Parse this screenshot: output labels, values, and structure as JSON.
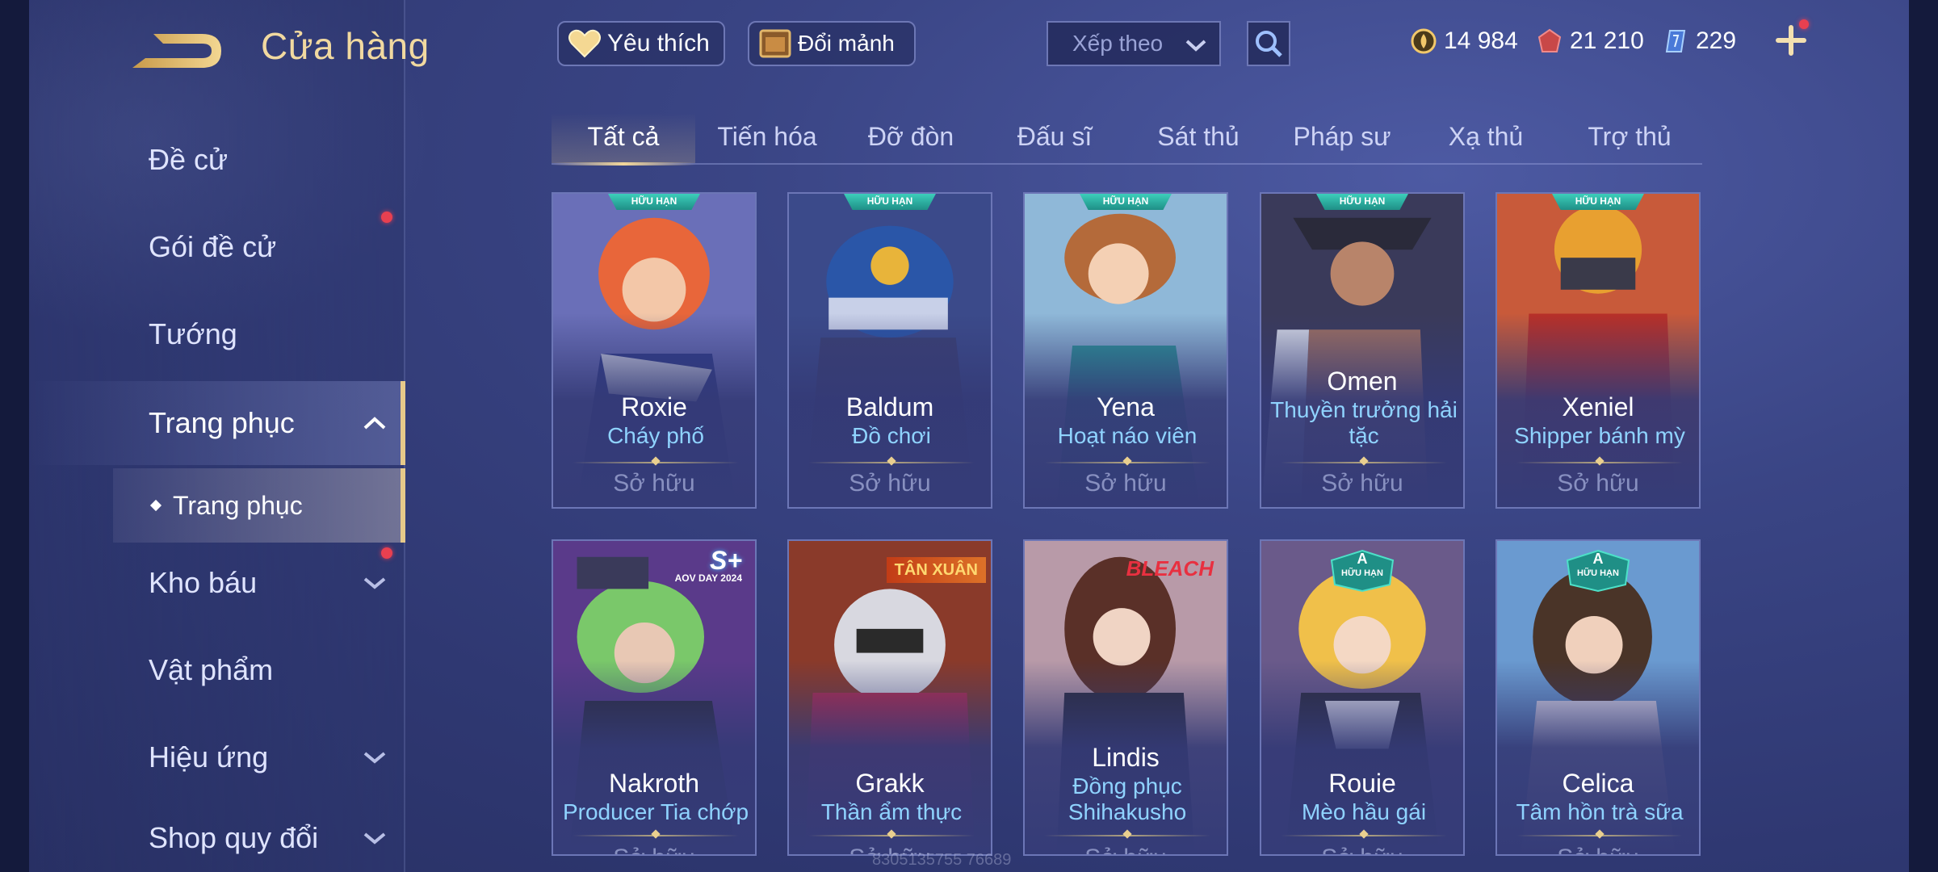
{
  "header": {
    "title": "Cửa hàng",
    "favorites_label": "Yêu thích",
    "exchange_label": "Đổi mảnh",
    "sort_label": "Xếp theo"
  },
  "currencies": [
    {
      "name": "gold-coin",
      "value": "14 984",
      "color": "#f2c86a"
    },
    {
      "name": "red-voucher",
      "value": "21 210",
      "color": "#e06a6a"
    },
    {
      "name": "blue-crystal",
      "value": "229",
      "color": "#7fb6ff"
    }
  ],
  "sidebar": {
    "items": [
      {
        "label": "Đề cử"
      },
      {
        "label": "Gói đề cử"
      },
      {
        "label": "Tướng"
      },
      {
        "label": "Trang phục"
      },
      {
        "label": "Kho báu"
      },
      {
        "label": "Vật phẩm"
      },
      {
        "label": "Hiệu ứng"
      },
      {
        "label": "Shop quy đổi"
      }
    ],
    "sub_item": "Trang phục"
  },
  "tabs": [
    "Tất cả",
    "Tiến hóa",
    "Đỡ đòn",
    "Đấu sĩ",
    "Sát thủ",
    "Pháp sư",
    "Xạ thủ",
    "Trợ thủ"
  ],
  "cards": [
    {
      "hero": "Roxie",
      "skin": "Cháy phố",
      "status": "Sở hữu",
      "badge": "HỮU HẠN"
    },
    {
      "hero": "Baldum",
      "skin": "Đồ chơi",
      "status": "Sở hữu",
      "badge": "HỮU HẠN"
    },
    {
      "hero": "Yena",
      "skin": "Hoạt náo viên",
      "status": "Sở hữu",
      "badge": "HỮU HẠN"
    },
    {
      "hero": "Omen",
      "skin": "Thuyền trưởng hải tặc",
      "status": "Sở hữu",
      "badge": "HỮU HẠN"
    },
    {
      "hero": "Xeniel",
      "skin": "Shipper bánh mỳ",
      "status": "Sở hữu",
      "badge": "HỮU HẠN"
    },
    {
      "hero": "Nakroth",
      "skin": "Producer Tia chớp",
      "status": "Sở hữu",
      "tag": "S+",
      "tag_sub": "AOV DAY 2024"
    },
    {
      "hero": "Grakk",
      "skin": "Thần ẩm thực",
      "status": "Sở hữu",
      "tag": "TÂN XUÂN"
    },
    {
      "hero": "Lindis",
      "skin": "Đồng phục Shihakusho",
      "status": "Sở hữu",
      "tag": "BLEACH"
    },
    {
      "hero": "Rouie",
      "skin": "Mèo hầu gái",
      "status": "Sở hữu",
      "badge": "HỮU HẠN",
      "rank": "A"
    },
    {
      "hero": "Celica",
      "skin": "Tâm hồn trà sữa",
      "status": "Sở hữu",
      "badge": "HỮU HẠN",
      "rank": "A"
    }
  ],
  "watermark": "8305135755 76689"
}
